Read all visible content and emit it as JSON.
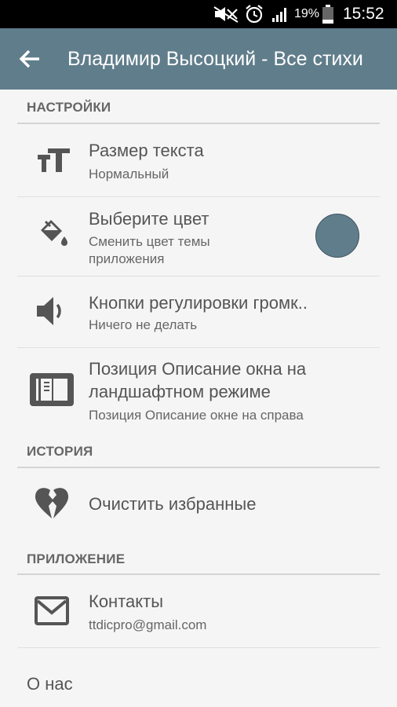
{
  "status_bar": {
    "battery_percent": "19%",
    "time": "15:52",
    "icons": [
      "mute-icon",
      "alarm-icon",
      "signal-icon",
      "battery-icon"
    ]
  },
  "app_bar": {
    "title": "Владимир Высоцкий - Все стихи"
  },
  "sections": {
    "settings": {
      "header": "НАСТРОЙКИ"
    },
    "history": {
      "header": "ИСТОРИЯ"
    },
    "application": {
      "header": "ПРИЛОЖЕНИЕ"
    }
  },
  "items": {
    "text_size": {
      "title": "Размер текста",
      "subtitle": "Нормальный",
      "icon": "text-size-icon"
    },
    "color": {
      "title": "Выберите цвет",
      "subtitle": "Сменить цвет темы приложения",
      "icon": "paint-bucket-icon",
      "value_color": "#607d8b"
    },
    "volume": {
      "title": "Кнопки регулировки громк..",
      "subtitle": "Ничего не делать",
      "icon": "volume-icon"
    },
    "position": {
      "title_line1": "Позиция Описание окна на",
      "title_line2": "ландшафтном режиме",
      "subtitle": "Позиция Описание окне на справа",
      "icon": "book-layout-icon"
    },
    "clear_favorites": {
      "title": "Очистить избранные",
      "icon": "broken-heart-icon"
    },
    "contacts": {
      "title": "Контакты",
      "subtitle": "ttdicpro@gmail.com",
      "icon": "mail-icon"
    },
    "about": {
      "title": "О нас"
    }
  },
  "colors": {
    "accent": "#607d8b",
    "status_bar": "#000000",
    "background": "#f5f5f5"
  }
}
